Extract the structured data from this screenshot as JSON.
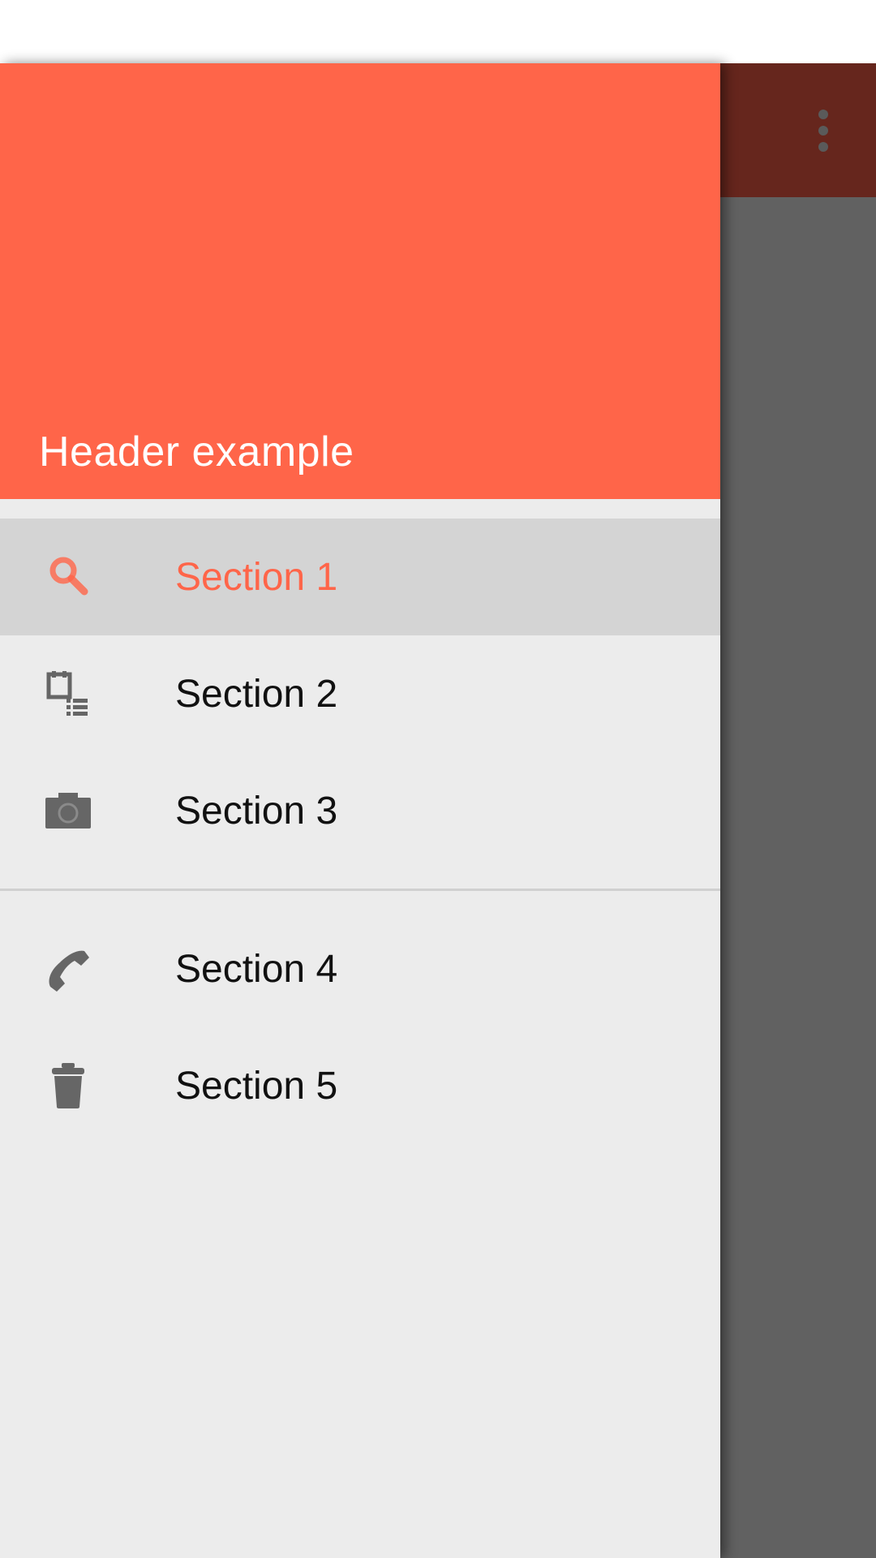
{
  "colors": {
    "accent": "#ff6549",
    "toolbar_dim": "#66261d",
    "scrim": "#616161",
    "drawer_bg": "#ececec",
    "selected_bg": "#d4d4d4",
    "icon_gray": "#666666"
  },
  "header": {
    "title": "Header example"
  },
  "toolbar": {
    "overflow_icon": "more-vert-icon"
  },
  "nav": {
    "items": [
      {
        "label": "Section 1",
        "icon": "search-icon",
        "selected": true
      },
      {
        "label": "Section 2",
        "icon": "calendar-list-icon",
        "selected": false
      },
      {
        "label": "Section 3",
        "icon": "camera-icon",
        "selected": false
      },
      {
        "label": "Section 4",
        "icon": "phone-icon",
        "selected": false
      },
      {
        "label": "Section 5",
        "icon": "trash-icon",
        "selected": false
      }
    ]
  }
}
